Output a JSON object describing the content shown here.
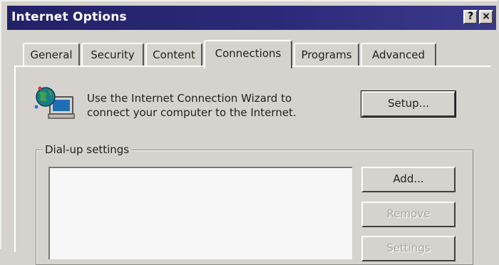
{
  "window": {
    "title": "Internet Options",
    "help_button": "?",
    "close_button": "×"
  },
  "tabs": [
    {
      "label": "General",
      "active": false
    },
    {
      "label": "Security",
      "active": false
    },
    {
      "label": "Content",
      "active": false
    },
    {
      "label": "Connections",
      "active": true
    },
    {
      "label": "Programs",
      "active": false
    },
    {
      "label": "Advanced",
      "active": false
    }
  ],
  "wizard": {
    "icon": "connection-wizard-icon",
    "text_line1": "Use the Internet Connection Wizard to",
    "text_line2": "connect your computer to the Internet.",
    "setup_button": "Setup..."
  },
  "dialup": {
    "legend": "Dial-up settings",
    "entries": [],
    "add_button": "Add...",
    "remove_button": "Remove",
    "settings_button": "Settings"
  }
}
